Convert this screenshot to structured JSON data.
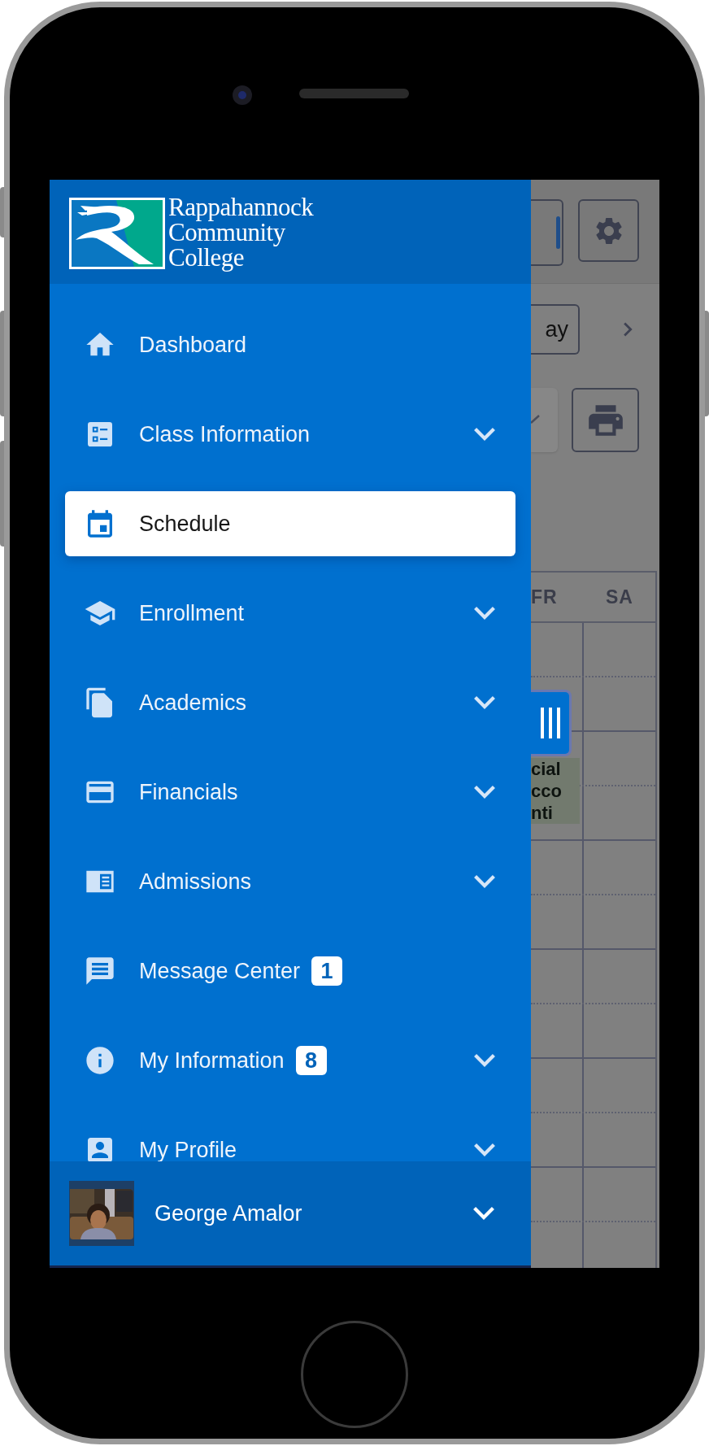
{
  "logo": {
    "lines": [
      "Rappahannock",
      "Community",
      "College"
    ]
  },
  "menu": [
    {
      "label": "Dashboard",
      "selected": false,
      "expandable": false
    },
    {
      "label": "Class Information",
      "selected": false,
      "expandable": true
    },
    {
      "label": "Schedule",
      "selected": true,
      "expandable": false
    },
    {
      "label": "Enrollment",
      "selected": false,
      "expandable": true
    },
    {
      "label": "Academics",
      "selected": false,
      "expandable": true
    },
    {
      "label": "Financials",
      "selected": false,
      "expandable": true
    },
    {
      "label": "Admissions",
      "selected": false,
      "expandable": true
    },
    {
      "label": "Message Center",
      "selected": false,
      "expandable": false,
      "badge": "1"
    },
    {
      "label": "My Information",
      "selected": false,
      "expandable": true,
      "badge": "8"
    },
    {
      "label": "My Profile",
      "selected": false,
      "expandable": true
    }
  ],
  "user": {
    "name": "George Amalor"
  },
  "background": {
    "view_button": "ay",
    "day_headers": [
      "FR",
      "SA"
    ],
    "event_lines": [
      "cial",
      "cco",
      "nti"
    ]
  }
}
